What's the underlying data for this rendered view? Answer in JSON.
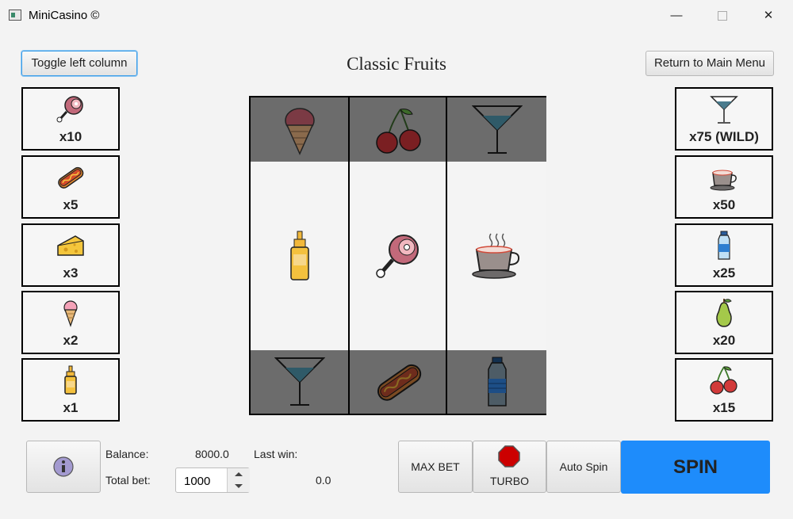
{
  "window": {
    "title": "MiniCasino ©",
    "minimize": "—",
    "close": "✕"
  },
  "header": {
    "toggle_label": "Toggle left column",
    "game_title": "Classic Fruits",
    "return_label": "Return to Main Menu"
  },
  "paytable_left": [
    {
      "icon": "ham-icon",
      "label": "x10"
    },
    {
      "icon": "hotdog-icon",
      "label": "x5"
    },
    {
      "icon": "cheese-icon",
      "label": "x3"
    },
    {
      "icon": "ice-cream-icon",
      "label": "x2"
    },
    {
      "icon": "mustard-icon",
      "label": "x1"
    }
  ],
  "paytable_right": [
    {
      "icon": "cocktail-icon",
      "label": "x75 (WILD)"
    },
    {
      "icon": "coffee-cup-icon",
      "label": "x50"
    },
    {
      "icon": "water-bottle-icon",
      "label": "x25"
    },
    {
      "icon": "pear-icon",
      "label": "x20"
    },
    {
      "icon": "cherry-icon",
      "label": "x15"
    }
  ],
  "reels": [
    [
      "ice-cream-icon",
      "mustard-icon",
      "cocktail-icon"
    ],
    [
      "cherry-icon",
      "ham-icon",
      "hotdog-icon"
    ],
    [
      "cocktail-icon",
      "coffee-cup-icon",
      "water-bottle-icon"
    ]
  ],
  "footer": {
    "balance_label": "Balance:",
    "balance_value": "8000.0",
    "last_win_label": "Last win:",
    "last_win_value": "0.0",
    "total_bet_label": "Total bet:",
    "total_bet_value": "1000",
    "max_bet_label": "MAX BET",
    "turbo_label": "TURBO",
    "auto_spin_label": "Auto Spin",
    "spin_label": "SPIN"
  },
  "colors": {
    "spin_button": "#1e8cfb",
    "reel_dim": "#6c6c6c",
    "turbo_stop": "#cc0000"
  }
}
